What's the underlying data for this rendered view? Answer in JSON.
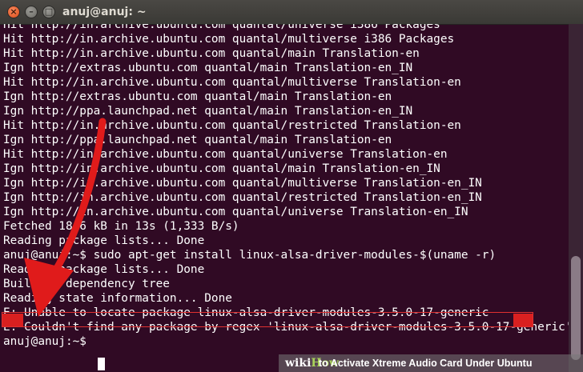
{
  "window": {
    "title": "anuj@anuj: ~",
    "close_glyph": "×",
    "minimize_glyph": "–",
    "maximize_glyph": "□"
  },
  "terminal": {
    "lines": [
      "Hit http://in.archive.ubuntu.com quantal/universe i386 Packages",
      "Hit http://in.archive.ubuntu.com quantal/multiverse i386 Packages",
      "Hit http://in.archive.ubuntu.com quantal/main Translation-en",
      "Ign http://extras.ubuntu.com quantal/main Translation-en_IN",
      "Hit http://in.archive.ubuntu.com quantal/multiverse Translation-en",
      "Ign http://extras.ubuntu.com quantal/main Translation-en",
      "Ign http://ppa.launchpad.net quantal/main Translation-en_IN",
      "Hit http://in.archive.ubuntu.com quantal/restricted Translation-en",
      "Ign http://ppa.launchpad.net quantal/main Translation-en",
      "Hit http://in.archive.ubuntu.com quantal/universe Translation-en",
      "Ign http://in.archive.ubuntu.com quantal/main Translation-en_IN",
      "Ign http://in.archive.ubuntu.com quantal/multiverse Translation-en_IN",
      "Ign http://in.archive.ubuntu.com quantal/restricted Translation-en_IN",
      "Ign http://in.archive.ubuntu.com quantal/universe Translation-en_IN",
      "Fetched 18.6 kB in 13s (1,333 B/s)",
      "Reading package lists... Done",
      "anuj@anuj:~$ sudo apt-get install linux-alsa-driver-modules-$(uname -r)",
      "Reading package lists... Done",
      "Building dependency tree",
      "Reading state information... Done",
      "E: Unable to locate package linux-alsa-driver-modules-3.5.0-17-generic",
      "E: Couldn't find any package by regex 'linux-alsa-driver-modules-3.5.0-17-generic'",
      "anuj@anuj:~$ "
    ]
  },
  "watermark": {
    "logo_wiki": "wiki",
    "logo_how": "How",
    "text": "to Activate Xtreme Audio Card Under Ubuntu"
  },
  "colors": {
    "terminal_bg": "#300a24",
    "text": "#ffffff",
    "annotation_red": "#e01b1b",
    "title_bar": "#3c3b37"
  }
}
